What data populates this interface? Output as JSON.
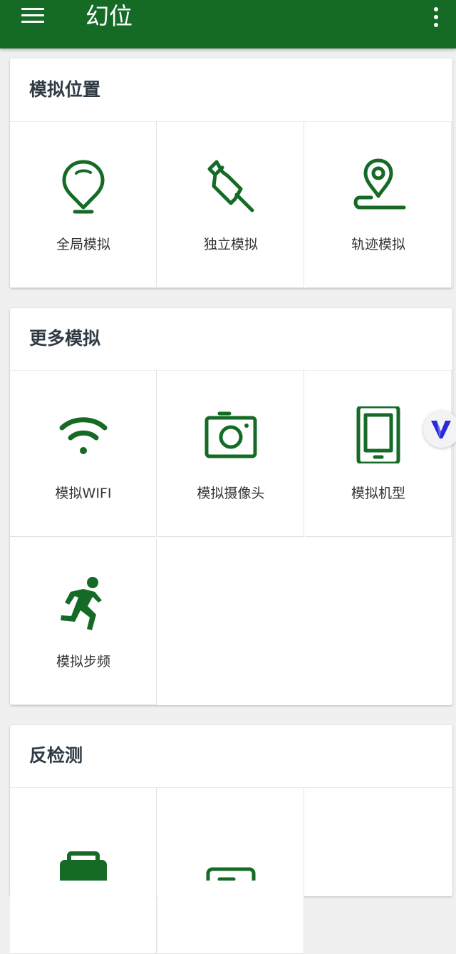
{
  "appbar": {
    "title": "幻位",
    "menu_icon": "menu-icon",
    "more_icon": "more-vert-icon",
    "color": "#156b26"
  },
  "sections": [
    {
      "title": "模拟位置",
      "items": [
        {
          "label": "全局模拟",
          "icon": "location-marker-icon"
        },
        {
          "label": "独立模拟",
          "icon": "pushpin-icon"
        },
        {
          "label": "轨迹模拟",
          "icon": "route-pin-icon"
        }
      ]
    },
    {
      "title": "更多模拟",
      "items": [
        {
          "label": "模拟WIFI",
          "icon": "wifi-icon"
        },
        {
          "label": "模拟摄像头",
          "icon": "camera-icon"
        },
        {
          "label": "模拟机型",
          "icon": "tablet-icon"
        },
        {
          "label": "模拟步频",
          "icon": "running-person-icon"
        }
      ]
    },
    {
      "title": "反检测",
      "items": [
        {
          "label": "",
          "icon": "app-icon"
        },
        {
          "label": "",
          "icon": "card-icon"
        }
      ]
    }
  ],
  "floating_button": {
    "icon": "v-logo-icon",
    "accent": "#2a2ad8"
  },
  "accent_color": "#156b26"
}
